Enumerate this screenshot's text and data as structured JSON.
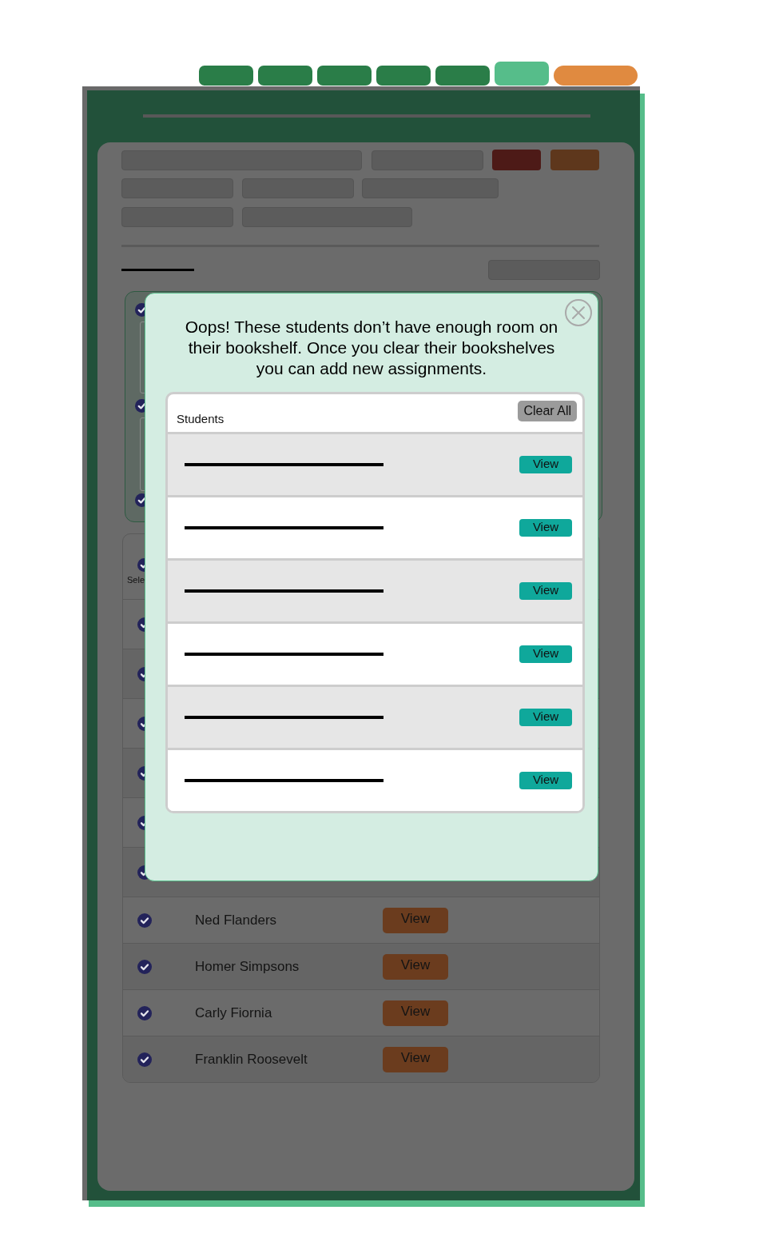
{
  "tabs": [
    {
      "selected": false
    },
    {
      "selected": false
    },
    {
      "selected": false
    },
    {
      "selected": false
    },
    {
      "selected": false
    },
    {
      "selected": true
    }
  ],
  "selected_groups": [
    {
      "checked": true
    },
    {
      "checked": true
    },
    {
      "checked": true
    }
  ],
  "student_table": {
    "header": {
      "label": "Sele",
      "checked": true
    },
    "rows": [
      {
        "checked": true
      },
      {
        "checked": true
      },
      {
        "checked": true
      },
      {
        "checked": true
      },
      {
        "checked": true
      },
      {
        "checked": true
      },
      {
        "checked": true,
        "name": "Ned Flanders",
        "action": "View"
      },
      {
        "checked": true,
        "name": "Homer Simpsons",
        "action": "View"
      },
      {
        "checked": true,
        "name": "Carly Fiornia",
        "action": "View"
      },
      {
        "checked": true,
        "name": "Franklin Roosevelt",
        "action": "View"
      }
    ]
  },
  "modal": {
    "message": "Oops! These students don’t have enough room on their bookshelf. Once you clear their bookshelves you can add new assignments.",
    "list": {
      "header": "Students",
      "clear_button": "Clear All",
      "rows": [
        {
          "action": "View"
        },
        {
          "action": "View"
        },
        {
          "action": "View"
        },
        {
          "action": "View"
        },
        {
          "action": "View"
        },
        {
          "action": "View"
        }
      ]
    }
  }
}
